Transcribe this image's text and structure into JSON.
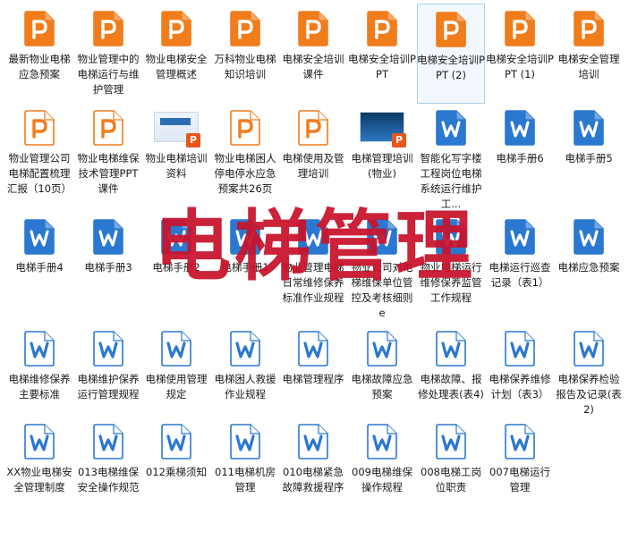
{
  "watermark": "电梯管理",
  "colors": {
    "ppt_orange": "#f07c1c",
    "word_blue": "#2b78d0",
    "watermark_red": "#c8142d",
    "selection": "#a9cff2"
  },
  "files": [
    {
      "label": "最新物业电梯应急预案",
      "type": "ppt"
    },
    {
      "label": "物业管理中的电梯运行与维护管理",
      "type": "ppt"
    },
    {
      "label": "物业电梯安全管理概述",
      "type": "ppt"
    },
    {
      "label": "万科物业电梯知识培训",
      "type": "ppt"
    },
    {
      "label": "电梯安全培训课件",
      "type": "ppt"
    },
    {
      "label": "电梯安全培训PPT",
      "type": "ppt"
    },
    {
      "label": "电梯安全培训PPT (2)",
      "type": "ppt",
      "selected": true
    },
    {
      "label": "电梯安全培训PPT (1)",
      "type": "ppt"
    },
    {
      "label": "电梯安全管理培训",
      "type": "ppt"
    },
    {
      "label": "物业管理公司电梯配置梳理汇报（10页）",
      "type": "ppt-outline"
    },
    {
      "label": "物业电梯维保技术管理PPT课件",
      "type": "ppt-outline"
    },
    {
      "label": "物业电梯培训资料",
      "type": "thumb-light"
    },
    {
      "label": "物业电梯困人停电停水应急预案共26页",
      "type": "ppt-outline"
    },
    {
      "label": "电梯使用及管理培训",
      "type": "ppt-outline"
    },
    {
      "label": "电梯管理培训(物业)",
      "type": "thumb-dark"
    },
    {
      "label": "智能化写字楼工程岗位电梯系统运行维护工...",
      "type": "word"
    },
    {
      "label": "电梯手册6",
      "type": "word"
    },
    {
      "label": "电梯手册5",
      "type": "word"
    },
    {
      "label": "电梯手册4",
      "type": "word"
    },
    {
      "label": "电梯手册3",
      "type": "word"
    },
    {
      "label": "电梯手册2",
      "type": "word"
    },
    {
      "label": "电梯手册1",
      "type": "word"
    },
    {
      "label": "物业管理电梯日常维修保养标准作业规程",
      "type": "word"
    },
    {
      "label": "物业公司对电梯维保单位管控及考核细则e",
      "type": "word"
    },
    {
      "label": "物业电梯运行维修保养监管工作规程",
      "type": "word"
    },
    {
      "label": "电梯运行巡查记录（表1）",
      "type": "word"
    },
    {
      "label": "电梯应急预案",
      "type": "word"
    },
    {
      "label": "电梯维修保养主要标准",
      "type": "word-outline"
    },
    {
      "label": "电梯维护保养运行管理规程",
      "type": "word-outline"
    },
    {
      "label": "电梯使用管理规定",
      "type": "word-outline"
    },
    {
      "label": "电梯困人救援作业规程",
      "type": "word-outline"
    },
    {
      "label": "电梯管理程序",
      "type": "word-outline"
    },
    {
      "label": "电梯故障应急预案",
      "type": "word-outline"
    },
    {
      "label": "电梯故障、报修处理表(表4)",
      "type": "word-outline"
    },
    {
      "label": "电梯保养维修计划（表3）",
      "type": "word-outline"
    },
    {
      "label": "电梯保养检验报告及记录(表2)",
      "type": "word-outline"
    },
    {
      "label": "XX物业电梯安全管理制度",
      "type": "word-outline"
    },
    {
      "label": "013电梯维保安全操作规范",
      "type": "word-outline"
    },
    {
      "label": "012乘梯须知",
      "type": "word-outline"
    },
    {
      "label": "011电梯机房管理",
      "type": "word-outline"
    },
    {
      "label": "010电梯紧急故障救援程序",
      "type": "word-outline"
    },
    {
      "label": "009电梯维保操作规程",
      "type": "word-outline"
    },
    {
      "label": "008电梯工岗位职责",
      "type": "word-outline"
    },
    {
      "label": "007电梯运行管理",
      "type": "word-outline"
    }
  ]
}
